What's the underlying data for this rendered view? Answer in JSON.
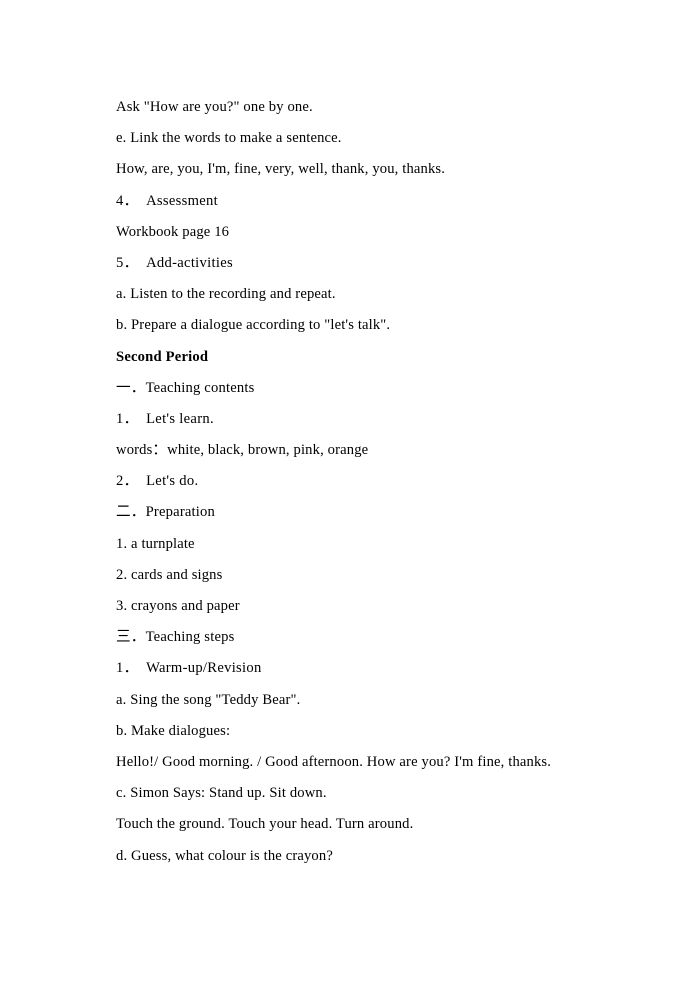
{
  "document": {
    "page_background": "#ffffff",
    "text_color": "#000000",
    "paragraphs": [
      {
        "id": "ask-how-are-you",
        "text": "Ask \"How are you?\" one by one.",
        "style": "normal"
      },
      {
        "id": "item-e-link-words",
        "text": "e. Link the words to make a sentence.",
        "style": "normal"
      },
      {
        "id": "word-list-sentence",
        "text": "How, are, you, I'm, fine, very, well, thank, you, thanks.",
        "style": "normal"
      },
      {
        "id": "step-4-assessment",
        "text": "4．　Assessment",
        "style": "numbered"
      },
      {
        "id": "workbook-page",
        "text": "Workbook page 16",
        "style": "normal"
      },
      {
        "id": "step-5-add-activities",
        "text": "5．　Add-activities",
        "style": "numbered"
      },
      {
        "id": "item-a-listen-repeat",
        "text": "a. Listen to the recording and repeat.",
        "style": "normal"
      },
      {
        "id": "item-b-prepare-dialogue",
        "text": "b. Prepare a dialogue according to \"let's talk\".",
        "style": "normal"
      },
      {
        "id": "second-period-heading",
        "text": "Second Period",
        "style": "heading"
      },
      {
        "id": "section-one-teaching-contents",
        "text": "一．Teaching contents",
        "style": "cjk-numbered"
      },
      {
        "id": "item-1-lets-learn",
        "text": "1．　Let's learn.",
        "style": "numbered"
      },
      {
        "id": "words-colours",
        "text": "words：white, black, brown, pink, orange",
        "style": "normal"
      },
      {
        "id": "item-2-lets-do",
        "text": "2．　Let's do.",
        "style": "numbered"
      },
      {
        "id": "section-two-preparation",
        "text": "二．Preparation",
        "style": "cjk-numbered"
      },
      {
        "id": "prep-1-turnplate",
        "text": "1. a turnplate",
        "style": "normal"
      },
      {
        "id": "prep-2-cards-signs",
        "text": "2. cards and signs",
        "style": "normal"
      },
      {
        "id": "prep-3-crayons-paper",
        "text": "3. crayons and paper",
        "style": "normal"
      },
      {
        "id": "section-three-teaching-steps",
        "text": "三．Teaching steps",
        "style": "cjk-numbered"
      },
      {
        "id": "step-1-warm-up-revision",
        "text": "1．　Warm-up/Revision",
        "style": "numbered"
      },
      {
        "id": "item-a-sing-teddy-bear",
        "text": "a. Sing the song \"Teddy Bear\".",
        "style": "normal"
      },
      {
        "id": "item-b-make-dialogues",
        "text": "b. Make dialogues:",
        "style": "normal"
      },
      {
        "id": "greetings-dialogue",
        "text": "Hello!/ Good morning. / Good afternoon. How are you? I'm fine, thanks.",
        "style": "normal"
      },
      {
        "id": "item-c-simon-says",
        "text": "c. Simon Says: Stand up. Sit down.",
        "style": "normal"
      },
      {
        "id": "simon-says-commands",
        "text": "Touch the ground. Touch your head. Turn around.",
        "style": "normal"
      },
      {
        "id": "item-d-guess-colour",
        "text": "d. Guess, what colour is the crayon?",
        "style": "normal"
      }
    ]
  }
}
